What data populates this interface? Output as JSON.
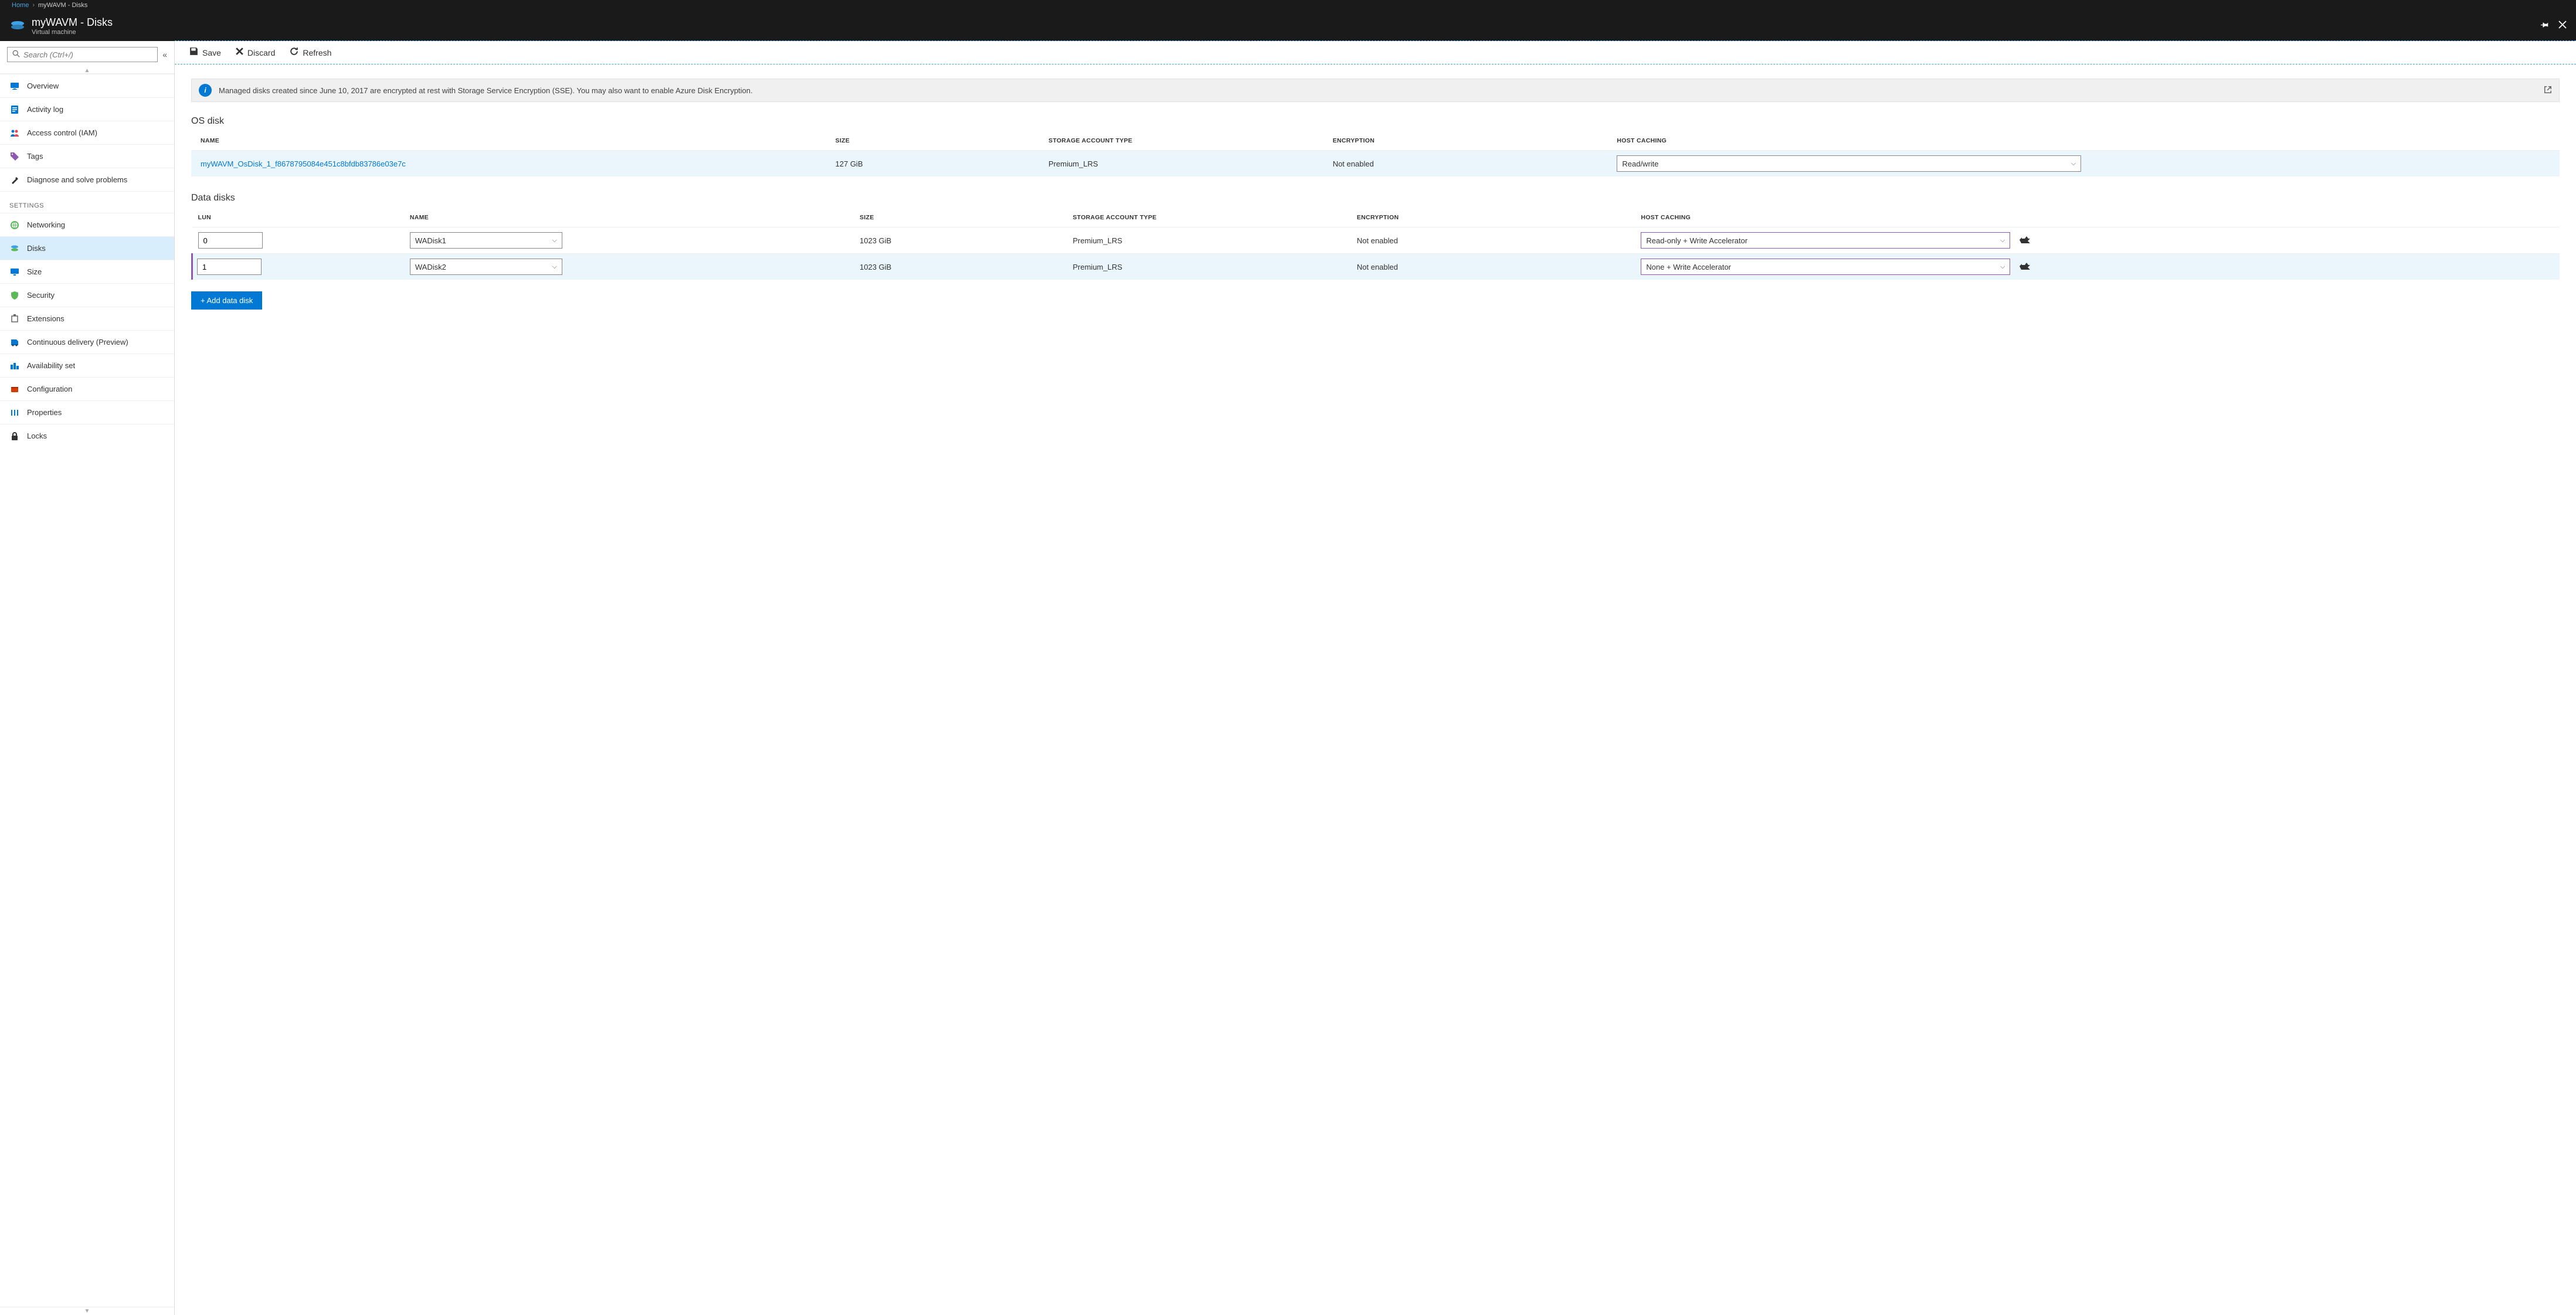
{
  "breadcrumb": {
    "home": "Home",
    "current": "myWAVM - Disks"
  },
  "header": {
    "title": "myWAVM - Disks",
    "subtitle": "Virtual machine"
  },
  "search": {
    "placeholder": "Search (Ctrl+/)"
  },
  "nav": {
    "items": [
      {
        "label": "Overview"
      },
      {
        "label": "Activity log"
      },
      {
        "label": "Access control (IAM)"
      },
      {
        "label": "Tags"
      },
      {
        "label": "Diagnose and solve problems"
      }
    ],
    "settings_heading": "SETTINGS",
    "settings": [
      {
        "label": "Networking"
      },
      {
        "label": "Disks"
      },
      {
        "label": "Size"
      },
      {
        "label": "Security"
      },
      {
        "label": "Extensions"
      },
      {
        "label": "Continuous delivery (Preview)"
      },
      {
        "label": "Availability set"
      },
      {
        "label": "Configuration"
      },
      {
        "label": "Properties"
      },
      {
        "label": "Locks"
      }
    ]
  },
  "toolbar": {
    "save": "Save",
    "discard": "Discard",
    "refresh": "Refresh"
  },
  "banner": {
    "text": "Managed disks created since June 10, 2017 are encrypted at rest with Storage Service Encryption (SSE). You may also want to enable Azure Disk Encryption."
  },
  "os_section": {
    "title": "OS disk",
    "columns": {
      "name": "NAME",
      "size": "SIZE",
      "storage": "STORAGE ACCOUNT TYPE",
      "encryption": "ENCRYPTION",
      "caching": "HOST CACHING"
    },
    "row": {
      "name": "myWAVM_OsDisk_1_f8678795084e451c8bfdb83786e03e7c",
      "size": "127 GiB",
      "storage": "Premium_LRS",
      "encryption": "Not enabled",
      "caching": "Read/write"
    }
  },
  "data_section": {
    "title": "Data disks",
    "columns": {
      "lun": "LUN",
      "name": "NAME",
      "size": "SIZE",
      "storage": "STORAGE ACCOUNT TYPE",
      "encryption": "ENCRYPTION",
      "caching": "HOST CACHING"
    },
    "rows": [
      {
        "lun": "0",
        "name": "WADisk1",
        "size": "1023 GiB",
        "storage": "Premium_LRS",
        "encryption": "Not enabled",
        "caching": "Read-only + Write Accelerator"
      },
      {
        "lun": "1",
        "name": "WADisk2",
        "size": "1023 GiB",
        "storage": "Premium_LRS",
        "encryption": "Not enabled",
        "caching": "None + Write Accelerator"
      }
    ],
    "add_button": "+ Add data disk"
  }
}
